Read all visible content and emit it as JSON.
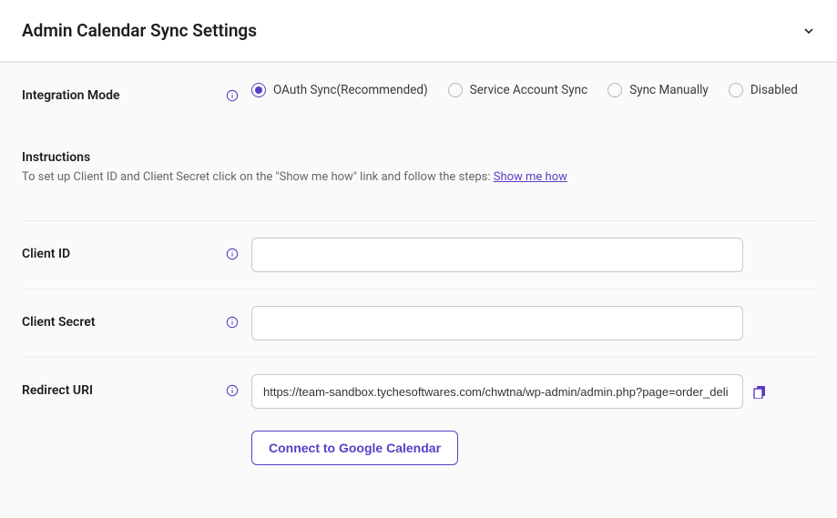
{
  "header": {
    "title": "Admin Calendar Sync Settings"
  },
  "integrationMode": {
    "label": "Integration Mode",
    "options": [
      {
        "label": "OAuth Sync(Recommended)",
        "selected": true
      },
      {
        "label": "Service Account Sync",
        "selected": false
      },
      {
        "label": "Sync Manually",
        "selected": false
      },
      {
        "label": "Disabled",
        "selected": false
      }
    ]
  },
  "instructions": {
    "title": "Instructions",
    "text": "To set up Client ID and Client Secret click on the \"Show me how\" link and follow the steps: ",
    "linkText": "Show me how"
  },
  "clientId": {
    "label": "Client ID",
    "value": ""
  },
  "clientSecret": {
    "label": "Client Secret",
    "value": ""
  },
  "redirectUri": {
    "label": "Redirect URI",
    "value": "https://team-sandbox.tychesoftwares.com/chwtna/wp-admin/admin.php?page=order_deli"
  },
  "connectButton": {
    "label": "Connect to Google Calendar"
  }
}
